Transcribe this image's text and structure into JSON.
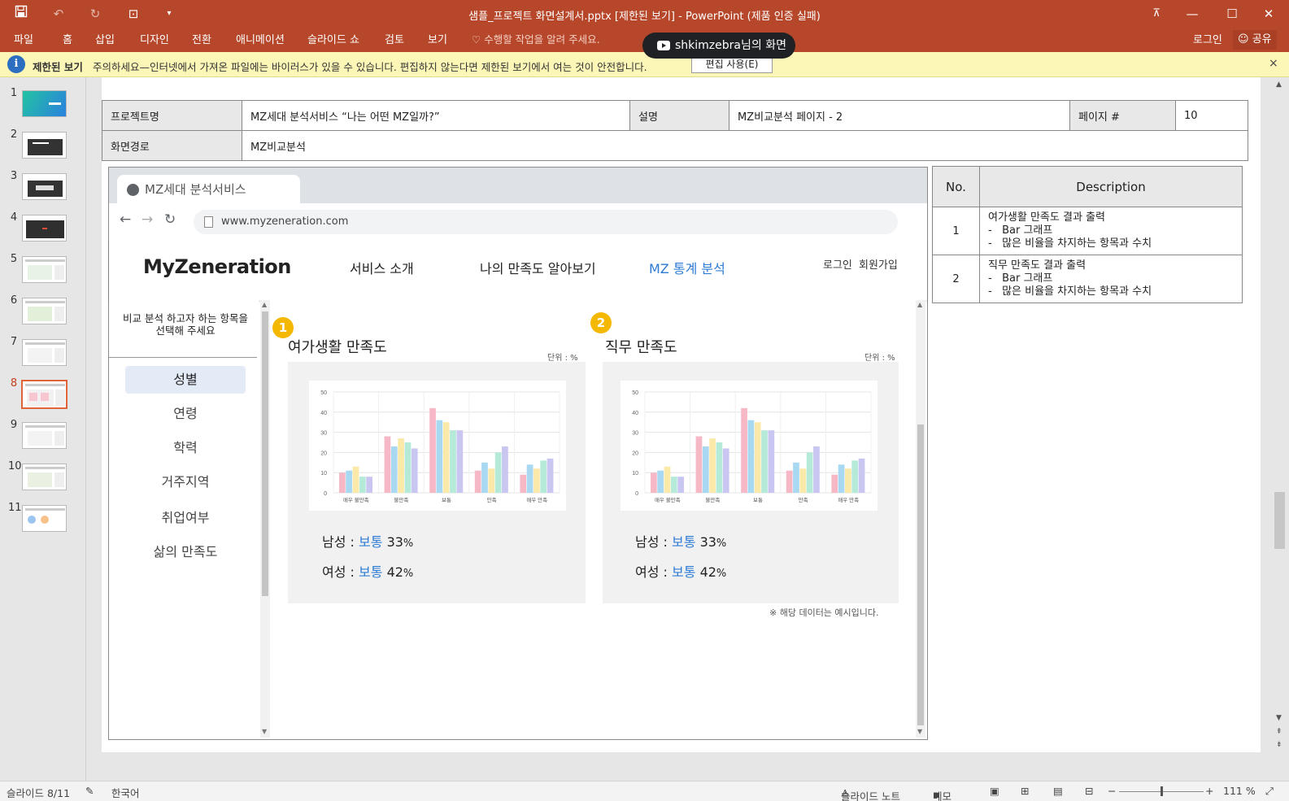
{
  "window": {
    "title": "샘플_프로젝트 화면설계서.pptx [제한된 보기] - PowerPoint (제품 인증 실패)",
    "icons": [
      "save-icon",
      "undo-icon",
      "redo-icon",
      "start-from-beginning-icon",
      "customize-qat-icon"
    ],
    "controls": [
      "ribbon-display-options-icon",
      "minimize-icon",
      "maximize-icon",
      "close-icon"
    ]
  },
  "ribbon": {
    "tabs": [
      "파일",
      "홈",
      "삽입",
      "디자인",
      "전환",
      "애니메이션",
      "슬라이드 쇼",
      "검토",
      "보기"
    ],
    "tell_me": "수행할 작업을 알려 주세요.",
    "sign_in": "로그인",
    "share": "공유"
  },
  "screen_share": {
    "label": "shkimzebra님의 화면"
  },
  "protected_view": {
    "title": "제한된 보기",
    "message": "주의하세요—인터넷에서 가져온 파일에는 바이러스가 있을 수 있습니다. 편집하지 않는다면 제한된 보기에서 여는 것이 안전합니다.",
    "enable_button": "편집 사용(E)",
    "close": "×"
  },
  "thumbnails": {
    "numbers": [
      "1",
      "2",
      "3",
      "4",
      "5",
      "6",
      "7",
      "8",
      "9",
      "10",
      "11"
    ],
    "active": 8
  },
  "slide": {
    "header": {
      "project_label": "프로젝트명",
      "project_value": "MZ세대 분석서비스 “나는 어떤 MZ일까?”",
      "desc_label": "설명",
      "desc_value": "MZ비교분석 페이지 - 2",
      "page_label": "페이지 #",
      "page_value": "10",
      "path_label": "화면경로",
      "path_value": "MZ비교분석"
    },
    "browser": {
      "tab_title": "MZ세대 분석서비스",
      "url": "www.myzeneration.com",
      "nav": {
        "back": "←",
        "forward": "→",
        "reload": "↻"
      }
    },
    "site": {
      "logo": "MyZeneration",
      "menu": [
        "서비스 소개",
        "나의 만족도 알아보기",
        "MZ 통계 분석"
      ],
      "menu_active": "MZ 통계 분석",
      "login": "로그인",
      "signup": "회원가입"
    },
    "sidebar": {
      "guide": "비교 분석 하고자 하는 항목을\n선택해 주세요",
      "items": [
        "성별",
        "연령",
        "학력",
        "거주지역",
        "취업여부",
        "삶의 만족도"
      ],
      "active": "성별"
    },
    "sections": [
      {
        "badge": "1",
        "title": "여가생활 만족도",
        "unit": "단위 : %",
        "results": [
          {
            "label": "남성 :",
            "value": "보통",
            "pct": "33",
            "sign": "%"
          },
          {
            "label": "여성 :",
            "value": "보통",
            "pct": "42",
            "sign": "%"
          }
        ]
      },
      {
        "badge": "2",
        "title": "직무 만족도",
        "unit": "단위 : %",
        "results": [
          {
            "label": "남성 :",
            "value": "보통",
            "pct": "33",
            "sign": "%"
          },
          {
            "label": "여성 :",
            "value": "보통",
            "pct": "42",
            "sign": "%"
          }
        ]
      }
    ],
    "note": "※ 해당 데이터는 예시입니다.",
    "description_table": {
      "headers": [
        "No.",
        "Description"
      ],
      "rows": [
        {
          "no": "1",
          "title": "여가생활 만족도 결과 출력",
          "b1": "-   Bar 그래프",
          "b2": "-   많은 비율을 차지하는 항목과 수치"
        },
        {
          "no": "2",
          "title": "직무 만족도 결과 출력",
          "b1": "-   Bar 그래프",
          "b2": "-   많은 비율을 차지하는 항목과 수치"
        }
      ]
    }
  },
  "chart_data": [
    {
      "type": "bar",
      "title": "",
      "categories": [
        "매우 불만족",
        "불만족",
        "보통",
        "만족",
        "매우 만족"
      ],
      "ylim": [
        0,
        50
      ],
      "yticks": [
        0,
        10,
        20,
        30,
        40,
        50
      ],
      "grid": true,
      "series_colors": [
        "#f7b8c6",
        "#a9d8f2",
        "#fbe9aa",
        "#b5ead9",
        "#c9c7f2",
        "#d7b5f0"
      ],
      "series": [
        {
          "values": [
            10,
            28,
            42,
            11,
            9
          ]
        },
        {
          "values": [
            11,
            23,
            36,
            15,
            14
          ]
        },
        {
          "values": [
            13,
            27,
            35,
            12,
            12
          ]
        },
        {
          "values": [
            8,
            25,
            31,
            20,
            16
          ]
        },
        {
          "values": [
            8,
            22,
            31,
            23,
            17
          ]
        }
      ]
    },
    {
      "type": "bar",
      "title": "",
      "categories": [
        "매우 불만족",
        "불만족",
        "보통",
        "만족",
        "매우 만족"
      ],
      "ylim": [
        0,
        50
      ],
      "yticks": [
        0,
        10,
        20,
        30,
        40,
        50
      ],
      "grid": true,
      "series_colors": [
        "#f7b8c6",
        "#a9d8f2",
        "#fbe9aa",
        "#b5ead9",
        "#c9c7f2",
        "#d7b5f0"
      ],
      "series": [
        {
          "values": [
            10,
            28,
            42,
            11,
            9
          ]
        },
        {
          "values": [
            11,
            23,
            36,
            15,
            14
          ]
        },
        {
          "values": [
            13,
            27,
            35,
            12,
            12
          ]
        },
        {
          "values": [
            8,
            25,
            31,
            20,
            16
          ]
        },
        {
          "values": [
            8,
            22,
            31,
            23,
            17
          ]
        }
      ]
    }
  ],
  "status_bar": {
    "slide": "슬라이드 8/11",
    "language": "한국어",
    "notes": "슬라이드 노트",
    "comments": "메모",
    "zoom": "111 %",
    "zoom_level": 0.5
  },
  "accent_colors": {
    "ribbon": "#b7472a",
    "link_blue": "#2e7bd6",
    "badge": "#f5b800"
  }
}
